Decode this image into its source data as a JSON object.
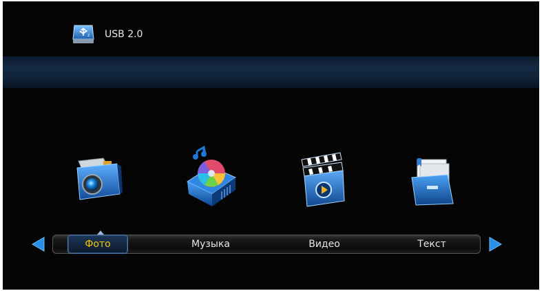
{
  "device": {
    "label": "USB 2.0",
    "icon": "usb-drive-icon"
  },
  "media_icons": [
    "camera-icon",
    "music-projector-icon",
    "video-clapperboard-icon",
    "text-folder-icon"
  ],
  "menu": {
    "items": [
      {
        "label": "Фото",
        "selected": true
      },
      {
        "label": "Музыка",
        "selected": false
      },
      {
        "label": "Видео",
        "selected": false
      },
      {
        "label": "Текст",
        "selected": false
      }
    ]
  },
  "colors": {
    "background": "#050505",
    "selected_text": "#f2c800",
    "accent_blue": "#2a8ee6",
    "text": "#e6e6e6"
  }
}
